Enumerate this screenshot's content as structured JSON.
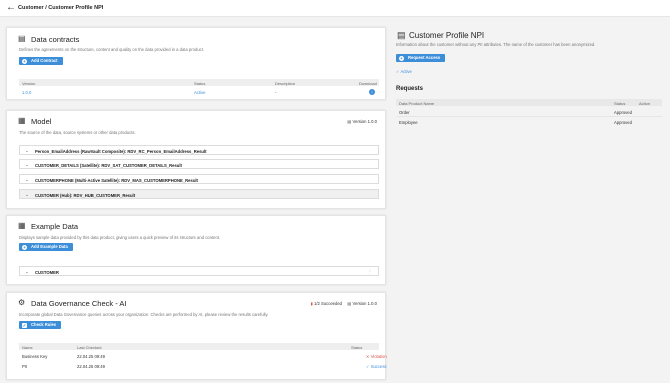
{
  "breadcrumb": "Customer / Customer Profile NPI",
  "contracts": {
    "title": "Data contracts",
    "description": "Defines the agreements on the structure, content and quality on the data provided in a data product.",
    "add_label": "Add Contract",
    "columns": [
      "Version",
      "Status",
      "Description",
      "Download"
    ],
    "rows": [
      {
        "version": "1.0.0",
        "status": "Active",
        "description": "-"
      }
    ]
  },
  "model": {
    "title": "Model",
    "version": "Version 1.0.0",
    "description": "The source of the data, source systems or other data products.",
    "items": [
      "Person_EmailAddress (RawVault Composite): RDV_RC_Person_EmailAddress_Result",
      "CUSTOMER_DETAILS (Satellite): RDV_SAT_CUSTOMER_DETAILS_Result",
      "CUSTOMERPHONE (Multi-Active Satellite): RDV_MAS_CUSTOMERPHONE_Result",
      "CUSTOMER (Hub): RDV_HUB_CUSTOMER_Result"
    ]
  },
  "example": {
    "title": "Example Data",
    "description": "Displays sample data provided by this data product, giving users a quick preview of its structure and content.",
    "add_label": "Add Example Data",
    "item": "CUSTOMER"
  },
  "governance": {
    "title": "Data Governance Check - AI",
    "succeeded": "1/2 Succeeded",
    "version": "Version 1.0.0",
    "description": "Incorporate global Data Governance queries across your organization. Checks are performed by AI, please review the results carefully.",
    "check_label": "Check Rules",
    "columns": [
      "Name",
      "Last Checked",
      "Status"
    ],
    "rows": [
      {
        "name": "Business Key",
        "checked": "22.04.25 09:49",
        "status": "Violation"
      },
      {
        "name": "PII",
        "checked": "22.04.25 09:49",
        "status": "Success"
      }
    ]
  },
  "profile": {
    "title": "Customer Profile NPI",
    "description": "Information about the customer without any PII attributes. The name of the customer has been anonymized.",
    "request_label": "Request Access",
    "active_label": "Active",
    "requests_title": "Requests",
    "columns": [
      "Data Product Name",
      "Status",
      "Action"
    ],
    "rows": [
      {
        "name": "Order",
        "status": "Approved"
      },
      {
        "name": "Employee",
        "status": "Approved"
      }
    ]
  },
  "colors": {
    "accent": "#3d8ed9",
    "violation": "#d9534f"
  }
}
